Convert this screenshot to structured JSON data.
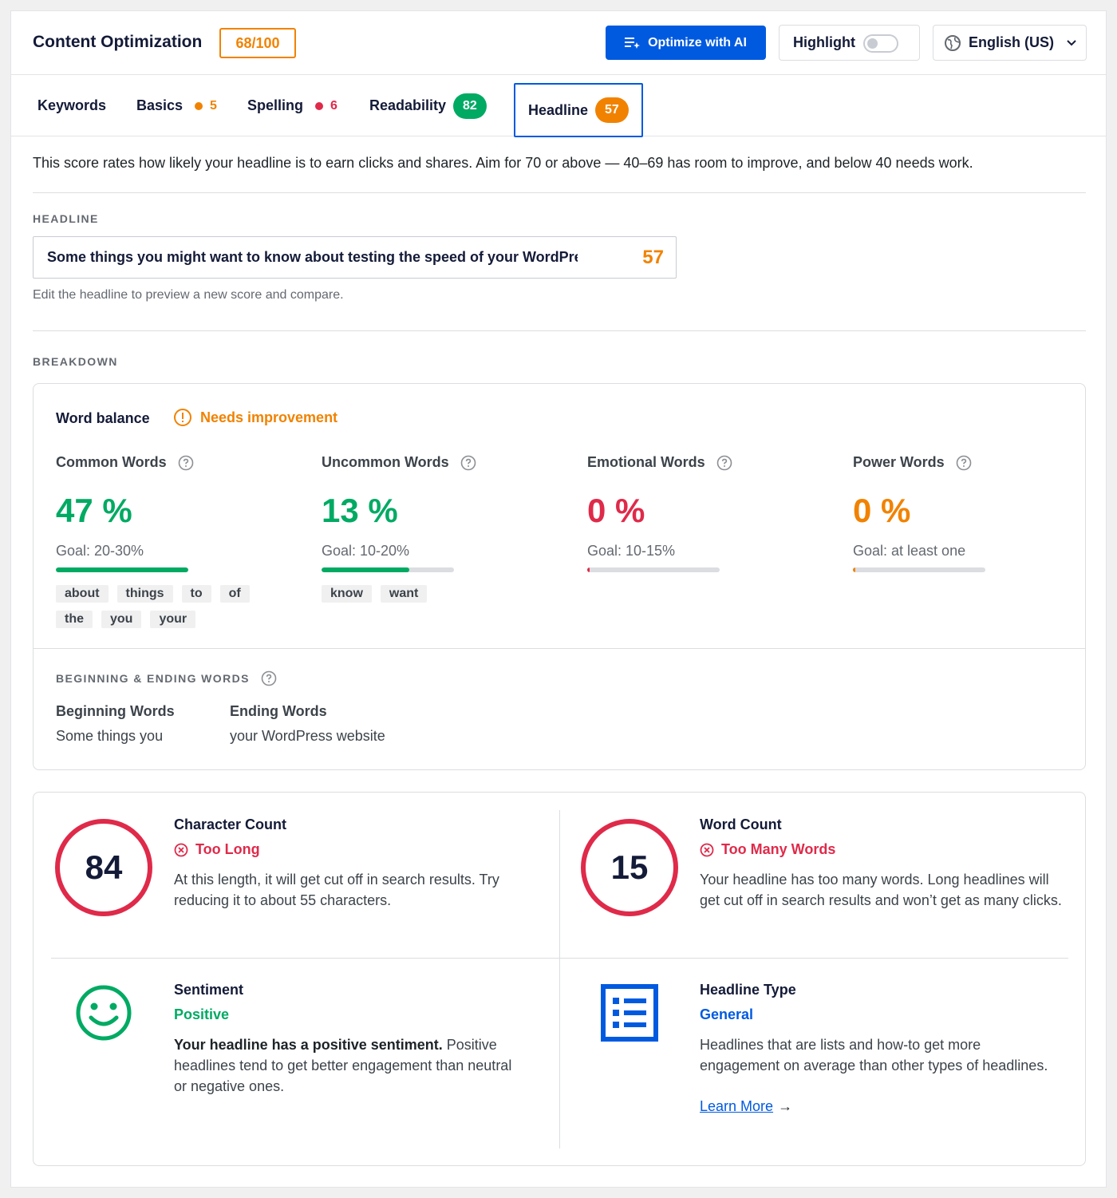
{
  "header": {
    "title": "Content Optimization",
    "score": "68/100",
    "optimize_label": "Optimize with AI",
    "highlight_label": "Highlight",
    "language": "English (US)"
  },
  "tabs": [
    {
      "label": "Keywords"
    },
    {
      "label": "Basics",
      "count": "5",
      "color": "#f18200"
    },
    {
      "label": "Spelling",
      "count": "6",
      "color": "#df2a4a"
    },
    {
      "label": "Readability",
      "score": "82",
      "color": "#00aa63"
    },
    {
      "label": "Headline",
      "score": "57",
      "color": "#f18200",
      "active": true
    }
  ],
  "intro": "This score rates how likely your headline is to earn clicks and shares. Aim for 70 or above — 40–69 has room to improve, and below 40 needs work.",
  "headline": {
    "section_label": "HEADLINE",
    "value": "Some things you might want to know about testing the speed of your WordPress website",
    "score": "57",
    "hint": "Edit the headline to preview a new score and compare."
  },
  "breakdown": {
    "section_label": "BREAKDOWN",
    "word_balance": {
      "title": "Word balance",
      "status": "Needs improvement",
      "metrics": [
        {
          "title": "Common Words",
          "value": "47 %",
          "goal": "Goal: 20-30%",
          "fill": 1.0,
          "color": "#00aa63",
          "words": [
            "about",
            "things",
            "to",
            "of",
            "the",
            "you",
            "your"
          ]
        },
        {
          "title": "Uncommon Words",
          "value": "13 %",
          "goal": "Goal: 10-20%",
          "fill": 0.66,
          "color": "#00aa63",
          "words": [
            "know",
            "want"
          ]
        },
        {
          "title": "Emotional Words",
          "value": "0 %",
          "goal": "Goal: 10-15%",
          "fill": 0.02,
          "color": "#df2a4a",
          "words": []
        },
        {
          "title": "Power Words",
          "value": "0 %",
          "goal": "Goal: at least one",
          "fill": 0.02,
          "color": "#f18200",
          "words": []
        }
      ]
    },
    "beginning_ending": {
      "section_label": "BEGINNING & ENDING WORDS",
      "beginning_title": "Beginning Words",
      "beginning_value": "Some things you",
      "ending_title": "Ending Words",
      "ending_value": "your WordPress website"
    }
  },
  "stats": {
    "character_count": {
      "value": "84",
      "title": "Character Count",
      "status": "Too Long",
      "description": "At this length, it will get cut off in search results. Try reducing it to about 55 characters."
    },
    "word_count": {
      "value": "15",
      "title": "Word Count",
      "status": "Too Many Words",
      "description": "Your headline has too many words. Long headlines will get cut off in search results and won’t get as many clicks."
    },
    "sentiment": {
      "title": "Sentiment",
      "status": "Positive",
      "lead": "Your headline has a positive sentiment.",
      "description": " Positive headlines tend to get better engagement than neutral or negative ones."
    },
    "headline_type": {
      "title": "Headline Type",
      "status": "General",
      "description": "Headlines that are lists and how-to get more engagement on average than other types of headlines.",
      "link": "Learn More",
      "arrow": "→"
    }
  },
  "colors": {
    "accent": "#005ae0",
    "warning": "#f18200",
    "error": "#df2a4a",
    "success": "#00aa63"
  },
  "icons": [
    "optimize-ai-icon",
    "globe-icon",
    "chevron-down-icon",
    "warning-circle-icon",
    "help-icon",
    "x-circle-icon",
    "smiley-icon",
    "list-icon",
    "arrow-right-icon"
  ]
}
